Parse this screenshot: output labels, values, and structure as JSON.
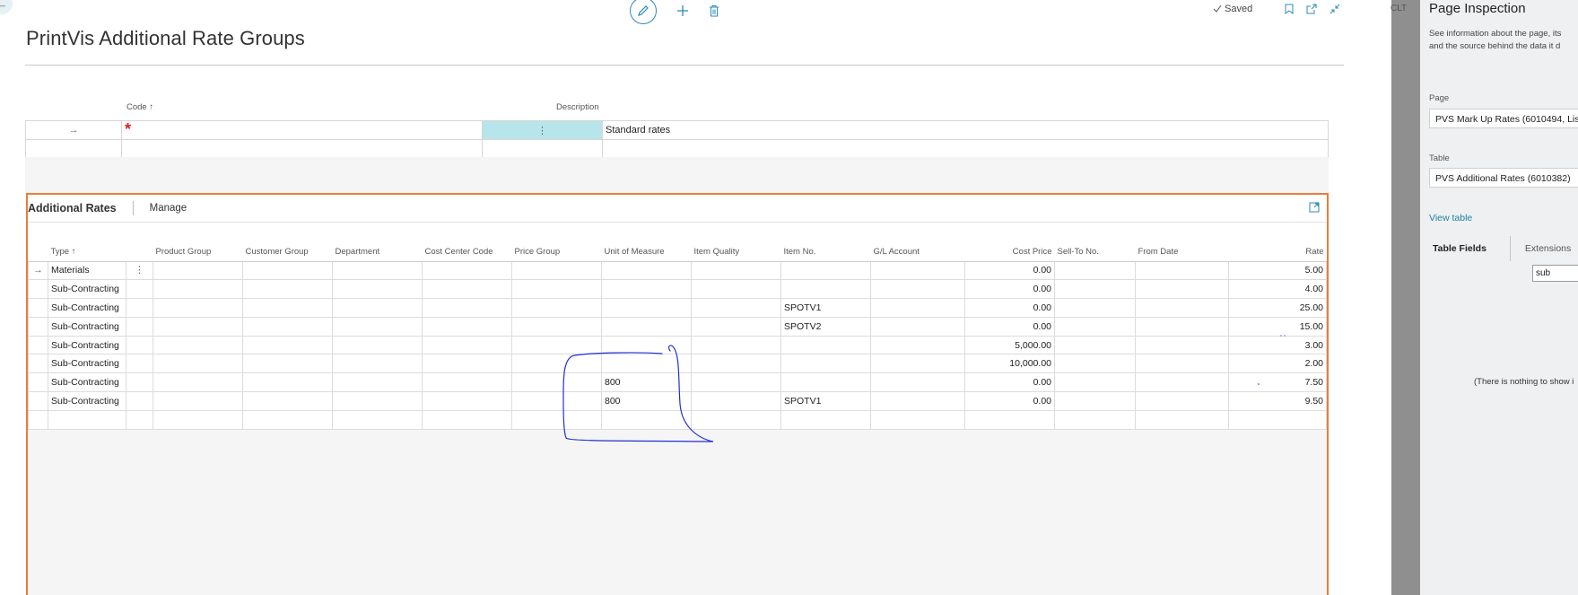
{
  "page": {
    "title": "PrintVis Additional Rate Groups",
    "status": "Saved"
  },
  "header_grid": {
    "columns": [
      "Code ↑",
      "Description"
    ],
    "rows": [
      {
        "code": "",
        "description": "Standard rates"
      },
      {
        "code": "",
        "description": ""
      }
    ]
  },
  "lines": {
    "title": "Additional Rates",
    "manage_label": "Manage",
    "columns": [
      "Type ↑",
      "Product Group",
      "Customer Group",
      "Department",
      "Cost Center Code",
      "Price Group",
      "Unit of Measure",
      "Item Quality",
      "Item No.",
      "G/L Account",
      "Cost Price",
      "Sell-To No.",
      "From Date",
      "Rate"
    ],
    "rows": [
      {
        "type": "Materials",
        "product_group": "",
        "customer_group": "",
        "department": "",
        "cost_center": "",
        "price_group": "",
        "uom": "",
        "item_quality": "",
        "item_no": "",
        "gl_account": "",
        "cost_price": "0.00",
        "sell_to": "",
        "from_date": "",
        "rate": "5.00"
      },
      {
        "type": "Sub-Contracting",
        "product_group": "",
        "customer_group": "",
        "department": "",
        "cost_center": "",
        "price_group": "",
        "uom": "",
        "item_quality": "",
        "item_no": "",
        "gl_account": "",
        "cost_price": "0.00",
        "sell_to": "",
        "from_date": "",
        "rate": "4.00"
      },
      {
        "type": "Sub-Contracting",
        "product_group": "",
        "customer_group": "",
        "department": "",
        "cost_center": "",
        "price_group": "",
        "uom": "",
        "item_quality": "",
        "item_no": "SPOTV1",
        "gl_account": "",
        "cost_price": "0.00",
        "sell_to": "",
        "from_date": "",
        "rate": "25.00"
      },
      {
        "type": "Sub-Contracting",
        "product_group": "",
        "customer_group": "",
        "department": "",
        "cost_center": "",
        "price_group": "",
        "uom": "",
        "item_quality": "",
        "item_no": "SPOTV2",
        "gl_account": "",
        "cost_price": "0.00",
        "sell_to": "",
        "from_date": "",
        "rate": "15.00"
      },
      {
        "type": "Sub-Contracting",
        "product_group": "",
        "customer_group": "",
        "department": "",
        "cost_center": "",
        "price_group": "",
        "uom": "",
        "item_quality": "",
        "item_no": "",
        "gl_account": "",
        "cost_price": "5,000.00",
        "sell_to": "",
        "from_date": "",
        "rate": "3.00"
      },
      {
        "type": "Sub-Contracting",
        "product_group": "",
        "customer_group": "",
        "department": "",
        "cost_center": "",
        "price_group": "",
        "uom": "",
        "item_quality": "",
        "item_no": "",
        "gl_account": "",
        "cost_price": "10,000.00",
        "sell_to": "",
        "from_date": "",
        "rate": "2.00"
      },
      {
        "type": "Sub-Contracting",
        "product_group": "",
        "customer_group": "",
        "department": "",
        "cost_center": "",
        "price_group": "",
        "uom": "800",
        "item_quality": "",
        "item_no": "",
        "gl_account": "",
        "cost_price": "0.00",
        "sell_to": "",
        "from_date": "",
        "rate": "7.50"
      },
      {
        "type": "Sub-Contracting",
        "product_group": "",
        "customer_group": "",
        "department": "",
        "cost_center": "",
        "price_group": "",
        "uom": "800",
        "item_quality": "",
        "item_no": "SPOTV1",
        "gl_account": "",
        "cost_price": "0.00",
        "sell_to": "",
        "from_date": "",
        "rate": "9.50"
      }
    ]
  },
  "strip_label": "CLT",
  "inspection": {
    "title": "Page Inspection",
    "description_line1": "See information about the page, its",
    "description_line2": "and the source behind the data it d",
    "page_label": "Page",
    "page_value": "PVS Mark Up Rates (6010494, Lis",
    "table_label": "Table",
    "table_value": "PVS Additional Rates (6010382)",
    "view_table": "View table",
    "tab_fields": "Table Fields",
    "tab_extensions": "Extensions",
    "filter_value": "sub",
    "empty_text": "(There is nothing to show i"
  },
  "colors": {
    "accent": "#2d8bb8",
    "selection": "#b8e4eb",
    "part_border": "#ea7d3c",
    "required": "#dd2222",
    "annotation": "#1f2fd6"
  }
}
